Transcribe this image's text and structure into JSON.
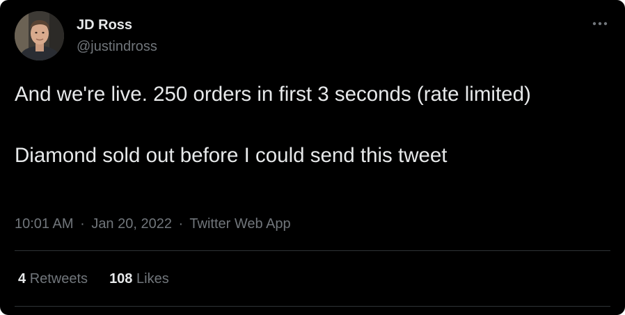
{
  "author": {
    "display_name": "JD Ross",
    "handle": "@justindross",
    "avatar_icon": "profile-photo"
  },
  "tweet": {
    "paragraphs": [
      "And we're live. 250 orders in first 3 seconds (rate limited)",
      "Diamond sold out before I could send this tweet"
    ]
  },
  "meta": {
    "time": "10:01 AM",
    "date": "Jan 20, 2022",
    "separator": "·",
    "source": "Twitter Web App"
  },
  "stats": {
    "retweets_count": "4",
    "retweets_label": "Retweets",
    "likes_count": "108",
    "likes_label": "Likes"
  },
  "more_icon": "more-horizontal-icon",
  "colors": {
    "background": "#000000",
    "primary_text": "#e7e9ea",
    "secondary_text": "#71767b",
    "divider": "#2f3336"
  }
}
